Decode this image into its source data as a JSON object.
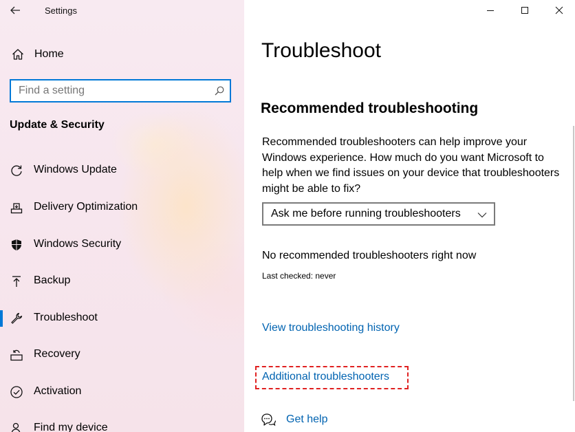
{
  "window": {
    "title": "Settings",
    "controls": [
      "minimize",
      "maximize",
      "close"
    ]
  },
  "sidebar": {
    "home_label": "Home",
    "search": {
      "placeholder": "Find a setting",
      "value": ""
    },
    "section_title": "Update & Security",
    "items": [
      {
        "label": "Windows Update",
        "icon": "refresh-icon",
        "selected": false
      },
      {
        "label": "Delivery Optimization",
        "icon": "delivery-optimization-icon",
        "selected": false
      },
      {
        "label": "Windows Security",
        "icon": "shield-icon",
        "selected": false
      },
      {
        "label": "Backup",
        "icon": "upload-arrow-icon",
        "selected": false
      },
      {
        "label": "Troubleshoot",
        "icon": "wrench-icon",
        "selected": true
      },
      {
        "label": "Recovery",
        "icon": "recovery-icon",
        "selected": false
      },
      {
        "label": "Activation",
        "icon": "checkmark-circle-icon",
        "selected": false
      },
      {
        "label": "Find my device",
        "icon": "person-location-icon",
        "selected": false
      }
    ]
  },
  "main": {
    "page_title": "Troubleshoot",
    "recommended": {
      "heading": "Recommended troubleshooting",
      "description": "Recommended troubleshooters can help improve your Windows experience. How much do you want Microsoft to help when we find issues on your device that troubleshooters might be able to fix?",
      "dropdown_value": "Ask me before running troubleshooters",
      "status": "No recommended troubleshooters right now",
      "last_checked": "Last checked: never"
    },
    "links": {
      "history": "View troubleshooting history",
      "additional": "Additional troubleshooters",
      "get_help": "Get help"
    }
  },
  "colors": {
    "accent": "#0078d7",
    "link": "#0063b1",
    "highlight_border": "#e02020"
  }
}
